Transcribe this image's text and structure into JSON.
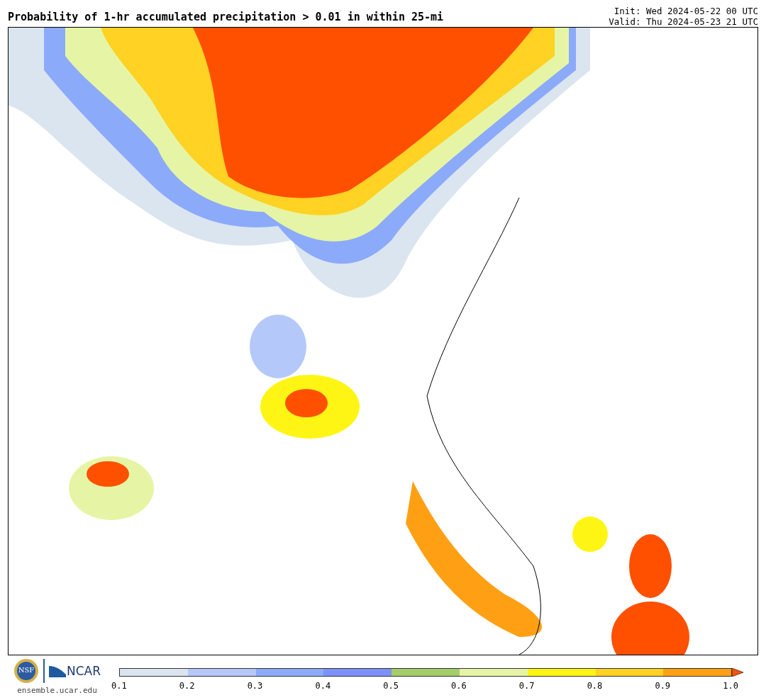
{
  "title": "Probability of 1-hr accumulated precipitation > 0.01 in within 25-mi",
  "init": "Init: Wed 2024-05-22 00 UTC",
  "valid": "Valid: Thu 2024-05-23 21 UTC",
  "logos": {
    "nsf": "NSF",
    "ncar": "NCAR",
    "site": "ensemble.ucar.edu"
  },
  "colorbar": {
    "segments": [
      {
        "color": "#dbe5f0"
      },
      {
        "color": "#b4c8fa"
      },
      {
        "color": "#8caafa"
      },
      {
        "color": "#7d91fa"
      },
      {
        "color": "#a5cd69"
      },
      {
        "color": "#e6f5a5"
      },
      {
        "color": "#fff514"
      },
      {
        "color": "#ffd223"
      },
      {
        "color": "#ffa014"
      }
    ],
    "ticks": [
      "0.1",
      "0.2",
      "0.3",
      "0.4",
      "0.5",
      "0.6",
      "0.7",
      "0.8",
      "0.9",
      "1.0"
    ]
  }
}
